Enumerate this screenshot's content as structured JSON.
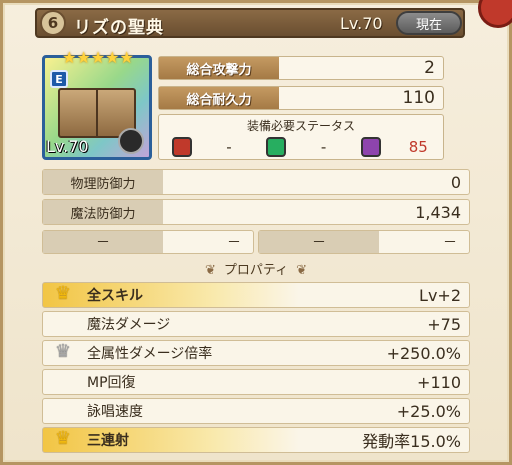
{
  "header": {
    "slot": "6",
    "title": "リズの聖典",
    "level": "Lv.70",
    "current_button": "現在"
  },
  "card": {
    "stars": "★★★★★",
    "rank": "E",
    "level": "Lv.70"
  },
  "summary": {
    "attack_label": "総合攻撃力",
    "attack_value": "2",
    "durability_label": "総合耐久力",
    "durability_value": "110",
    "equip_title": "装備必要ステータス",
    "req_red": "-",
    "req_green": "-",
    "req_purple": "85"
  },
  "stats": {
    "phys_def_label": "物理防御力",
    "phys_def_value": "0",
    "mag_def_label": "魔法防御力",
    "mag_def_value": "1,434",
    "empty_left_label": "－",
    "empty_left_value": "－",
    "empty_right_label": "－",
    "empty_right_value": "－"
  },
  "properties": {
    "title": "プロパティ",
    "items": [
      {
        "name": "全スキル",
        "value": "Lv+2"
      },
      {
        "name": "魔法ダメージ",
        "value": "+75"
      },
      {
        "name": "全属性ダメージ倍率",
        "value": "+250.0%"
      },
      {
        "name": "MP回復",
        "value": "+110"
      },
      {
        "name": "詠唱速度",
        "value": "+25.0%"
      },
      {
        "name": "三連射",
        "value": "発動率15.0%"
      }
    ]
  },
  "colors": {
    "accent_gold": "#f1b90f",
    "stat_red": "#c0392b"
  }
}
